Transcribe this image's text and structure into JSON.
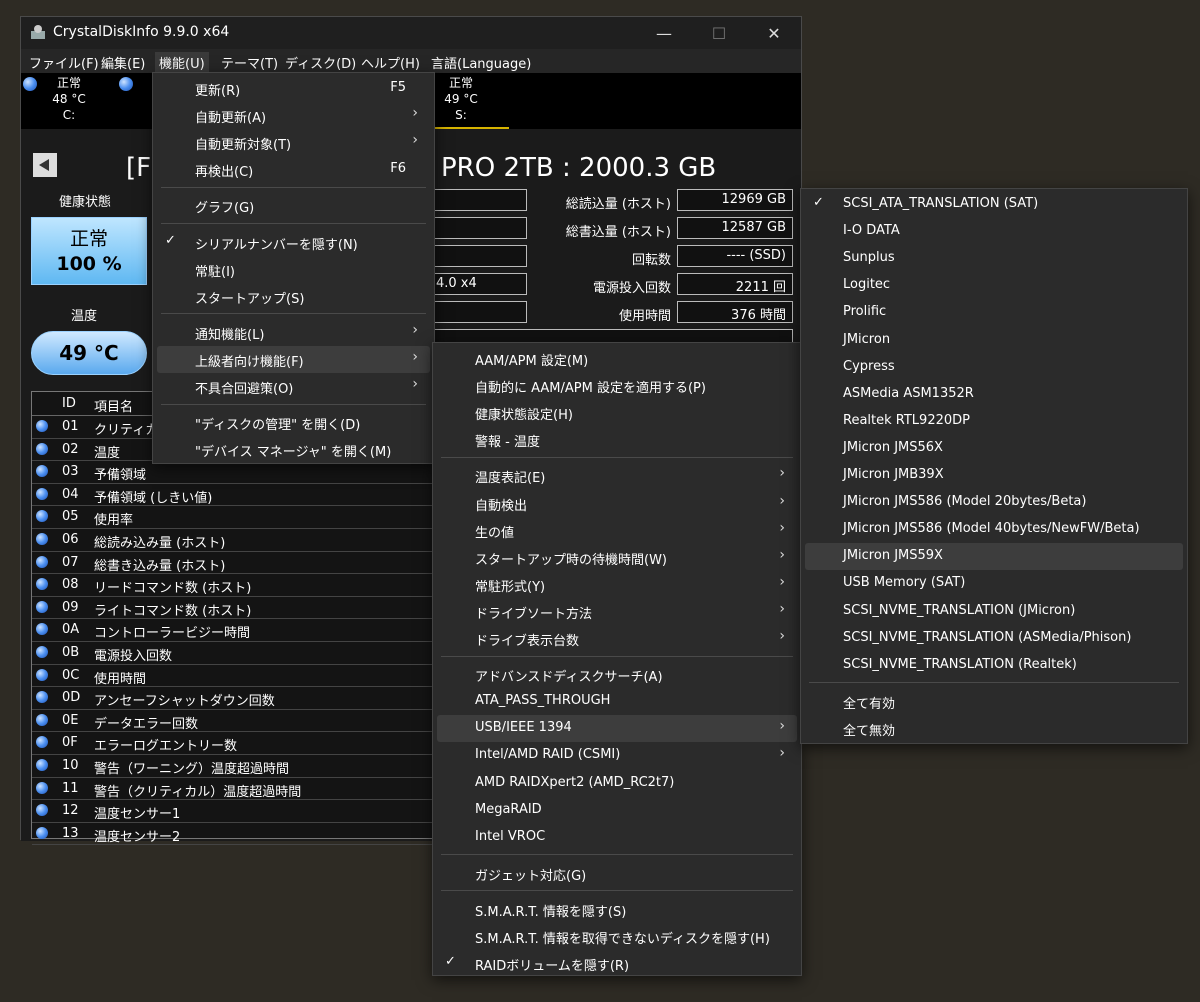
{
  "window": {
    "title": "CrystalDiskInfo 9.9.0 x64",
    "min": "—",
    "max": "☐",
    "close": "✕"
  },
  "menubar": [
    "ファイル(F)",
    "編集(E)",
    "機能(U)",
    "テーマ(T)",
    "ディスク(D)",
    "ヘルプ(H)",
    "言語(Language)"
  ],
  "disks": [
    {
      "status": "正常",
      "temp": "48 °C",
      "letter": "C:"
    },
    {
      "status": "正常",
      "temp": "49 °C",
      "letter": "S:"
    }
  ],
  "disk_title_left": "[F",
  "disk_title_right": "PRO 2TB : 2000.3 GB",
  "health": {
    "label": "健康状態",
    "status": "正常",
    "percent": "100 %"
  },
  "temperature": {
    "label": "温度",
    "value": "49 °C"
  },
  "info": {
    "left_fragment": "4.0 x4",
    "rows": [
      {
        "label": "総読込量 (ホスト)",
        "value": "12969 GB"
      },
      {
        "label": "総書込量 (ホスト)",
        "value": "12587 GB"
      },
      {
        "label": "回転数",
        "value": "---- (SSD)"
      },
      {
        "label": "電源投入回数",
        "value": "2211 回"
      },
      {
        "label": "使用時間",
        "value": "376 時間"
      }
    ]
  },
  "smart": {
    "headers": {
      "id": "ID",
      "name": "項目名"
    },
    "rows": [
      {
        "id": "01",
        "name": "クリティカルワ"
      },
      {
        "id": "02",
        "name": "温度"
      },
      {
        "id": "03",
        "name": "予備領域"
      },
      {
        "id": "04",
        "name": "予備領域 (しきい値)"
      },
      {
        "id": "05",
        "name": "使用率"
      },
      {
        "id": "06",
        "name": "総読み込み量 (ホスト)"
      },
      {
        "id": "07",
        "name": "総書き込み量 (ホスト)"
      },
      {
        "id": "08",
        "name": "リードコマンド数 (ホスト)"
      },
      {
        "id": "09",
        "name": "ライトコマンド数 (ホスト)"
      },
      {
        "id": "0A",
        "name": "コントローラービジー時間"
      },
      {
        "id": "0B",
        "name": "電源投入回数"
      },
      {
        "id": "0C",
        "name": "使用時間"
      },
      {
        "id": "0D",
        "name": "アンセーフシャットダウン回数"
      },
      {
        "id": "0E",
        "name": "データエラー回数"
      },
      {
        "id": "0F",
        "name": "エラーログエントリー数"
      },
      {
        "id": "10",
        "name": "警告（ワーニング）温度超過時間"
      },
      {
        "id": "11",
        "name": "警告（クリティカル）温度超過時間"
      },
      {
        "id": "12",
        "name": "温度センサー1"
      },
      {
        "id": "13",
        "name": "温度センサー2"
      }
    ]
  },
  "menu1": [
    {
      "label": "更新(R)",
      "shortcut": "F5"
    },
    {
      "label": "自動更新(A)",
      "submenu": true
    },
    {
      "label": "自動更新対象(T)",
      "submenu": true
    },
    {
      "label": "再検出(C)",
      "shortcut": "F6"
    },
    {
      "sep": true
    },
    {
      "label": "グラフ(G)"
    },
    {
      "sep": true
    },
    {
      "label": "シリアルナンバーを隠す(N)",
      "checked": true
    },
    {
      "label": "常駐(I)"
    },
    {
      "label": "スタートアップ(S)"
    },
    {
      "sep": true
    },
    {
      "label": "通知機能(L)",
      "submenu": true
    },
    {
      "label": "上級者向け機能(F)",
      "submenu": true,
      "highlight": true
    },
    {
      "label": "不具合回避策(O)",
      "submenu": true
    },
    {
      "sep": true
    },
    {
      "label": "\"ディスクの管理\" を開く(D)"
    },
    {
      "label": "\"デバイス マネージャ\" を開く(M)"
    }
  ],
  "menu2": [
    {
      "label": "AAM/APM 設定(M)"
    },
    {
      "label": "自動的に AAM/APM 設定を適用する(P)"
    },
    {
      "label": "健康状態設定(H)"
    },
    {
      "label": "警報 - 温度"
    },
    {
      "sep": true
    },
    {
      "label": "温度表記(E)",
      "submenu": true
    },
    {
      "label": "自動検出",
      "submenu": true
    },
    {
      "label": "生の値",
      "submenu": true
    },
    {
      "label": "スタートアップ時の待機時間(W)",
      "submenu": true
    },
    {
      "label": "常駐形式(Y)",
      "submenu": true
    },
    {
      "label": "ドライブソート方法",
      "submenu": true
    },
    {
      "label": "ドライブ表示台数",
      "submenu": true
    },
    {
      "sep": true
    },
    {
      "label": "アドバンスドディスクサーチ(A)"
    },
    {
      "label": "ATA_PASS_THROUGH"
    },
    {
      "label": "USB/IEEE 1394",
      "submenu": true,
      "highlight": true
    },
    {
      "label": "Intel/AMD RAID (CSMI)",
      "submenu": true
    },
    {
      "label": "AMD RAIDXpert2 (AMD_RC2t7)"
    },
    {
      "label": "MegaRAID"
    },
    {
      "label": "Intel VROC"
    },
    {
      "sep": true
    },
    {
      "label": "ガジェット対応(G)"
    },
    {
      "sep": true
    },
    {
      "label": "S.M.A.R.T. 情報を隠す(S)"
    },
    {
      "label": "S.M.A.R.T. 情報を取得できないディスクを隠す(H)"
    },
    {
      "label": "RAIDボリュームを隠す(R)",
      "checked": true
    }
  ],
  "menu3": [
    {
      "label": "SCSI_ATA_TRANSLATION (SAT)",
      "checked": true
    },
    {
      "label": "I-O DATA"
    },
    {
      "label": "Sunplus"
    },
    {
      "label": "Logitec"
    },
    {
      "label": "Prolific"
    },
    {
      "label": "JMicron"
    },
    {
      "label": "Cypress"
    },
    {
      "label": "ASMedia ASM1352R"
    },
    {
      "label": "Realtek RTL9220DP"
    },
    {
      "label": "JMicron JMS56X"
    },
    {
      "label": "JMicron JMB39X"
    },
    {
      "label": "JMicron JMS586 (Model 20bytes/Beta)"
    },
    {
      "label": "JMicron JMS586 (Model 40bytes/NewFW/Beta)"
    },
    {
      "label": "JMicron JMS59X",
      "highlight": true
    },
    {
      "label": "USB Memory (SAT)"
    },
    {
      "label": "SCSI_NVME_TRANSLATION (JMicron)"
    },
    {
      "label": "SCSI_NVME_TRANSLATION (ASMedia/Phison)"
    },
    {
      "label": "SCSI_NVME_TRANSLATION (Realtek)"
    },
    {
      "sep": true
    },
    {
      "label": "全て有効"
    },
    {
      "label": "全て無効"
    }
  ],
  "glyphs": {
    "arrow": "›",
    "check": "✓"
  }
}
